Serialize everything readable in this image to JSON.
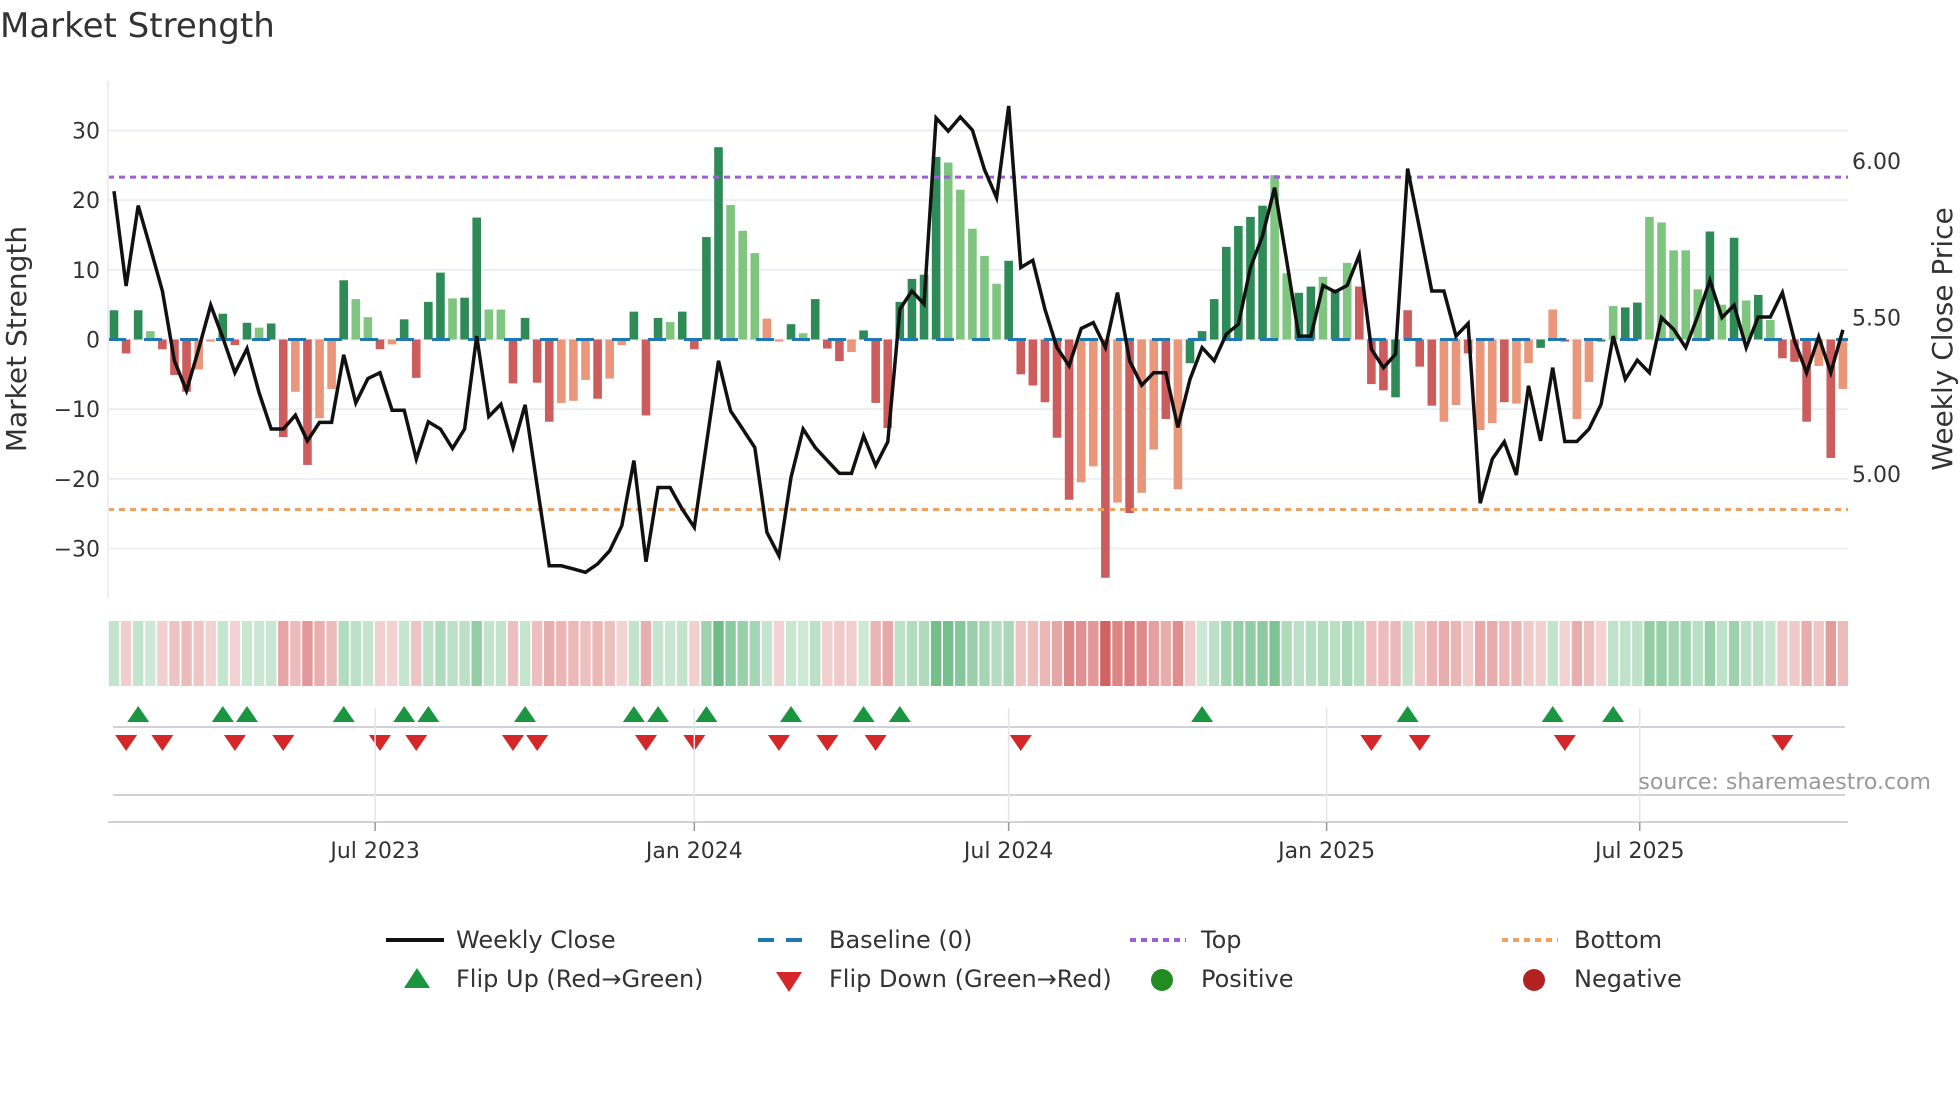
{
  "title": "Market Strength",
  "source": "source: sharemaestro.com",
  "colors": {
    "strong_green": "#2e8b57",
    "light_green": "#7fc47f",
    "strong_red": "#cd5c5c",
    "light_red": "#e9967a",
    "baseline": "#1f77b4",
    "top": "#9b5fd6",
    "bottom": "#f0a060",
    "flip_up": "#1a9641",
    "flip_down": "#d62728",
    "positive": "#228b22",
    "negative": "#b22222",
    "close": "#111111"
  },
  "legend": [
    {
      "label": "Weekly Close",
      "icon": "line"
    },
    {
      "label": "Baseline (0)",
      "icon": "dash"
    },
    {
      "label": "Top",
      "icon": "dot-purple"
    },
    {
      "label": "Bottom",
      "icon": "dot-orange"
    },
    {
      "label": "Flip Up (Red→Green)",
      "icon": "triangle-up"
    },
    {
      "label": "Flip Down (Green→Red)",
      "icon": "triangle-down"
    },
    {
      "label": "Positive",
      "icon": "circle-green"
    },
    {
      "label": "Negative",
      "icon": "circle-red"
    }
  ],
  "chart_data": {
    "type": "bar",
    "title": "Market Strength",
    "ylabel": "Market Strength",
    "y2label": "Weekly Close Price",
    "ylim": [
      -37.1,
      37.1
    ],
    "y2lim": [
      4.604,
      6.256
    ],
    "yticks": [
      30,
      20,
      10,
      0,
      -10,
      -20,
      -30
    ],
    "ytick_labels": [
      "30",
      "20",
      "10",
      "0",
      "−10",
      "−20",
      "−30"
    ],
    "y2ticks": [
      6.0,
      5.5,
      5.0
    ],
    "y2tick_labels": [
      "6.00",
      "5.50",
      "5.00"
    ],
    "xticks": [
      {
        "week": 21.6,
        "label": "Jul 2023"
      },
      {
        "week": 48.0,
        "label": "Jan 2024"
      },
      {
        "week": 74.0,
        "label": "Jul 2024"
      },
      {
        "week": 100.3,
        "label": "Jan 2025"
      },
      {
        "week": 126.2,
        "label": "Jul 2025"
      }
    ],
    "top_level": 23.3,
    "bottom_level": -24.4,
    "baseline": 0,
    "strength": [
      4.2,
      -2,
      4.2,
      1.2,
      -1.4,
      -5.1,
      -7.5,
      -4.3,
      -0.3,
      3.7,
      -0.8,
      2.4,
      1.7,
      2.3,
      -14,
      -7.5,
      -18,
      -11.3,
      -7.1,
      8.5,
      5.8,
      3.2,
      -1.4,
      -0.7,
      2.9,
      -5.5,
      5.4,
      9.6,
      5.9,
      6,
      17.5,
      4.3,
      4.3,
      -6.3,
      3.1,
      -6.2,
      -11.8,
      -9.1,
      -8.8,
      -5.8,
      -8.5,
      -5.6,
      -0.8,
      4,
      -10.9,
      3.1,
      2.5,
      4,
      -1.4,
      14.7,
      27.6,
      19.3,
      15.6,
      12.4,
      3,
      -0.3,
      2.2,
      0.9,
      5.8,
      -1.3,
      -3.1,
      -1.8,
      1.3,
      -9.1,
      -12.7,
      5.4,
      8.7,
      9.3,
      26.2,
      25.4,
      21.5,
      15.9,
      12,
      8,
      11.3,
      -5,
      -6.6,
      -9,
      -14.1,
      -23,
      -20.5,
      -18.2,
      -34.2,
      -23.4,
      -24.9,
      -22,
      -15.8,
      -11.4,
      -21.5,
      -3.4,
      1.2,
      5.8,
      13.3,
      16.3,
      17.6,
      19.2,
      23.6,
      9.5,
      6.7,
      7.6,
      9,
      7.2,
      11,
      7.6,
      -6.4,
      -7.3,
      -8.3,
      4.2,
      -3.9,
      -9.5,
      -11.8,
      -9.4,
      -2,
      -13,
      -12,
      -9,
      -9.2,
      -3.4,
      -1.2,
      4.3,
      -0.3,
      -11.4,
      -6.1,
      -0.3,
      4.8,
      4.6,
      5.3,
      17.6,
      16.8,
      12.8,
      12.8,
      7.2,
      15.5,
      5,
      14.6,
      5.6,
      6.4,
      2.8,
      -2.7,
      -3.2,
      -11.8,
      -3.8,
      -17,
      -7.1
    ],
    "shade": "GRGgRRRrrGRGgGRrRrrGggRrGRGGgGGggRGRRrrrRrrGRGgGRGGgggrrGgGRRrGRRGGGGgggggGRRRRRrrRrRrrRrGGGGGGGggGGgGgRRRGRRRrrRrrRrrGrRrrGgGGgggggGgGgGgRRRrRr",
    "weekly_close": [
      5.904,
      5.601,
      5.858,
      5.723,
      5.585,
      5.362,
      5.266,
      5.399,
      5.54,
      5.436,
      5.324,
      5.401,
      5.26,
      5.144,
      5.144,
      5.188,
      5.106,
      5.165,
      5.165,
      5.381,
      5.227,
      5.305,
      5.324,
      5.204,
      5.204,
      5.048,
      5.167,
      5.144,
      5.082,
      5.144,
      5.441,
      5.184,
      5.223,
      5.085,
      5.221,
      4.963,
      4.707,
      4.707,
      4.697,
      4.686,
      4.713,
      4.755,
      4.835,
      5.043,
      4.72,
      4.957,
      4.957,
      4.888,
      4.83,
      5.096,
      5.362,
      5.202,
      5.144,
      5.085,
      4.814,
      4.739,
      4.989,
      5.144,
      5.085,
      5.043,
      5.002,
      5.002,
      5.122,
      5.027,
      5.103,
      5.527,
      5.585,
      5.543,
      6.138,
      6.096,
      6.141,
      6.099,
      5.973,
      5.883,
      6.176,
      5.66,
      5.683,
      5.527,
      5.404,
      5.346,
      5.465,
      5.484,
      5.404,
      5.58,
      5.362,
      5.284,
      5.324,
      5.324,
      5.149,
      5.303,
      5.404,
      5.362,
      5.447,
      5.479,
      5.66,
      5.761,
      5.915,
      5.681,
      5.441,
      5.441,
      5.603,
      5.582,
      5.603,
      5.7,
      5.399,
      5.34,
      5.383,
      5.976,
      5.782,
      5.585,
      5.585,
      5.441,
      5.481,
      4.907,
      5.048,
      5.103,
      4.997,
      5.282,
      5.106,
      5.34,
      5.104,
      5.104,
      5.144,
      5.223,
      5.441,
      5.303,
      5.364,
      5.324,
      5.5,
      5.463,
      5.404,
      5.505,
      5.619,
      5.5,
      5.54,
      5.404,
      5.502,
      5.502,
      5.58,
      5.426,
      5.324,
      5.439,
      5.324,
      5.461
    ],
    "flip_up_weeks": [
      2,
      9,
      11,
      19,
      24,
      26,
      34,
      43,
      45,
      49,
      56,
      62,
      65,
      90,
      107,
      119,
      124
    ],
    "flip_down_weeks": [
      1,
      4,
      10,
      14,
      22,
      25,
      33,
      35,
      44,
      48,
      55,
      59,
      63,
      75,
      104,
      108,
      120,
      138
    ],
    "grid": true,
    "legend_placement": "bottom"
  }
}
